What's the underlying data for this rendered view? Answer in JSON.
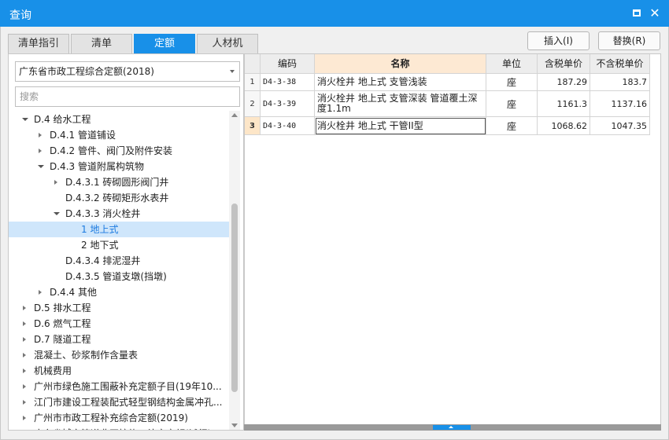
{
  "window": {
    "title": "查询"
  },
  "tabs": [
    {
      "label": "清单指引",
      "active": false
    },
    {
      "label": "清单",
      "active": false
    },
    {
      "label": "定额",
      "active": true
    },
    {
      "label": "人材机",
      "active": false
    }
  ],
  "actions": {
    "insert_label": "插入(I)",
    "replace_label": "替换(R)"
  },
  "left": {
    "library_selected": "广东省市政工程综合定额(2018)",
    "search_placeholder": "搜索",
    "tree": [
      {
        "label": "D.4 给水工程",
        "level": 0,
        "toggle": "collapse",
        "selected": false
      },
      {
        "label": "D.4.1 管道铺设",
        "level": 1,
        "toggle": "expand",
        "selected": false
      },
      {
        "label": "D.4.2 管件、阀门及附件安装",
        "level": 1,
        "toggle": "expand",
        "selected": false
      },
      {
        "label": "D.4.3 管道附属构筑物",
        "level": 1,
        "toggle": "collapse",
        "selected": false
      },
      {
        "label": "D.4.3.1 砖砌圆形阀门井",
        "level": 2,
        "toggle": "expand",
        "selected": false
      },
      {
        "label": "D.4.3.2 砖砌矩形水表井",
        "level": 2,
        "toggle": "none",
        "selected": false
      },
      {
        "label": "D.4.3.3 消火栓井",
        "level": 2,
        "toggle": "collapse",
        "selected": false
      },
      {
        "label": "1 地上式",
        "level": 3,
        "toggle": "none",
        "selected": true
      },
      {
        "label": "2 地下式",
        "level": 3,
        "toggle": "none",
        "selected": false
      },
      {
        "label": "D.4.3.4 排泥湿井",
        "level": 2,
        "toggle": "none",
        "selected": false
      },
      {
        "label": "D.4.3.5 管道支墩(挡墩)",
        "level": 2,
        "toggle": "none",
        "selected": false
      },
      {
        "label": "D.4.4 其他",
        "level": 1,
        "toggle": "expand",
        "selected": false
      },
      {
        "label": "D.5 排水工程",
        "level": 0,
        "toggle": "expand",
        "selected": false
      },
      {
        "label": "D.6 燃气工程",
        "level": 0,
        "toggle": "expand",
        "selected": false
      },
      {
        "label": "D.7 隧道工程",
        "level": 0,
        "toggle": "expand",
        "selected": false
      },
      {
        "label": "混凝土、砂浆制作含量表",
        "level": 0,
        "toggle": "expand",
        "selected": false
      },
      {
        "label": "机械费用",
        "level": 0,
        "toggle": "expand",
        "selected": false
      },
      {
        "label": "广州市绿色施工围蔽补充定额子目(19年10...",
        "level": 0,
        "toggle": "expand",
        "selected": false
      },
      {
        "label": "江门市建设工程装配式轻型钢结构金属冲孔...",
        "level": 0,
        "toggle": "expand",
        "selected": false
      },
      {
        "label": "广州市市政工程补充综合定额(2019)",
        "level": 0,
        "toggle": "expand",
        "selected": false
      },
      {
        "label": "广东省城市管道非开挖施工补充定额(试行)",
        "level": 0,
        "toggle": "expand",
        "selected": false
      }
    ]
  },
  "grid": {
    "columns": [
      "编码",
      "名称",
      "单位",
      "含税单价",
      "不含税单价"
    ],
    "rows": [
      {
        "num": "1",
        "code": "D4-3-38",
        "name": "消火栓井 地上式 支管浅装",
        "unit": "座",
        "price_tax": "187.29",
        "price_notax": "183.7",
        "current": false
      },
      {
        "num": "2",
        "code": "D4-3-39",
        "name": "消火栓井 地上式 支管深装 管道覆土深度1.1m",
        "unit": "座",
        "price_tax": "1161.3",
        "price_notax": "1137.16",
        "current": false
      },
      {
        "num": "3",
        "code": "D4-3-40",
        "name": "消火栓井 地上式 干管II型",
        "unit": "座",
        "price_tax": "1068.62",
        "price_notax": "1047.35",
        "current": true
      }
    ]
  },
  "colors": {
    "accent": "#1890e8",
    "selected_row": "#cfe6fb",
    "header_highlight": "#fde9d3"
  }
}
